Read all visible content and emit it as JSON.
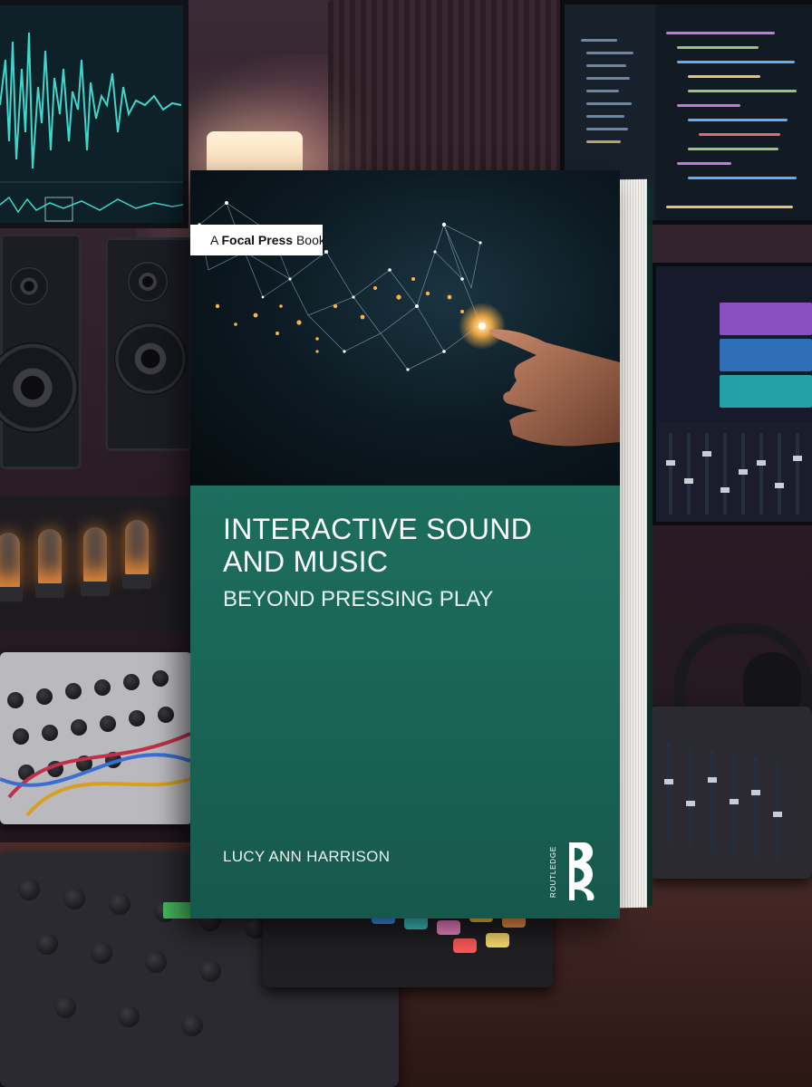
{
  "book": {
    "publisher_tag": {
      "prefix": "A ",
      "brand": "Focal Press",
      "suffix": " Book"
    },
    "title_line1": "INTERACTIVE SOUND",
    "title_line2": "AND MUSIC",
    "subtitle": "BEYOND PRESSING PLAY",
    "author": "LUCY ANN HARRISON",
    "imprint_logo": {
      "icon": "routledge-r-logo-icon",
      "wordmark": "ROUTLEDGE"
    }
  },
  "colors": {
    "cover_green": "#1d6e5e",
    "cover_dark": "#0c1a22",
    "spark_gold": "#ffb347",
    "waveform_cyan": "#39d0c8"
  }
}
